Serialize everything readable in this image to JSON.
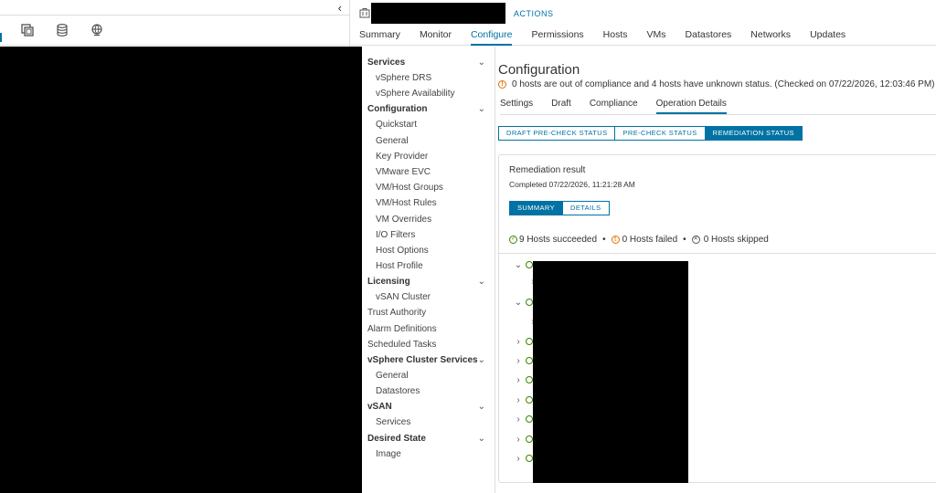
{
  "header": {
    "actions_label": "ACTIONS",
    "tabs": [
      {
        "label": "Summary",
        "active": false
      },
      {
        "label": "Monitor",
        "active": false
      },
      {
        "label": "Configure",
        "active": true
      },
      {
        "label": "Permissions",
        "active": false
      },
      {
        "label": "Hosts",
        "active": false
      },
      {
        "label": "VMs",
        "active": false
      },
      {
        "label": "Datastores",
        "active": false
      },
      {
        "label": "Networks",
        "active": false
      },
      {
        "label": "Updates",
        "active": false
      }
    ]
  },
  "left_pane": {
    "collapse_glyph": "‹",
    "icons": [
      "hosts-clusters-icon",
      "vms-templates-icon",
      "storage-icon",
      "networking-icon"
    ]
  },
  "side_nav": {
    "services": {
      "label": "Services",
      "items": [
        "vSphere DRS",
        "vSphere Availability"
      ]
    },
    "configuration": {
      "label": "Configuration",
      "items": [
        "Quickstart",
        "General",
        "Key Provider",
        "VMware EVC",
        "VM/Host Groups",
        "VM/Host Rules",
        "VM Overrides",
        "I/O Filters",
        "Host Options",
        "Host Profile"
      ]
    },
    "licensing": {
      "label": "Licensing",
      "items": [
        "vSAN Cluster"
      ]
    },
    "top_items": [
      "Trust Authority",
      "Alarm Definitions",
      "Scheduled Tasks"
    ],
    "cluster_services": {
      "label": "vSphere Cluster Services",
      "items": [
        "General",
        "Datastores"
      ]
    },
    "vsan": {
      "label": "vSAN",
      "items": [
        "Services"
      ]
    },
    "desired_state": {
      "label": "Desired State",
      "items": [
        "Image"
      ]
    }
  },
  "content": {
    "title": "Configuration",
    "warning": "0 hosts are out of compliance and 4 hosts have unknown status. (Checked on 07/22/2026, 12:03:46 PM)",
    "sub_tabs": [
      {
        "label": "Settings",
        "active": false
      },
      {
        "label": "Draft",
        "active": false
      },
      {
        "label": "Compliance",
        "active": false
      },
      {
        "label": "Operation Details",
        "active": true
      }
    ],
    "status_buttons": [
      {
        "label": "DRAFT PRE-CHECK STATUS",
        "active": false
      },
      {
        "label": "PRE-CHECK STATUS",
        "active": false
      },
      {
        "label": "REMEDIATION STATUS",
        "active": true
      }
    ],
    "result": {
      "heading": "Remediation result",
      "completed": "Completed 07/22/2026, 11:21:28 AM",
      "summary_label": "SUMMARY",
      "details_label": "DETAILS",
      "succeeded": "9 Hosts succeeded",
      "failed": "0 Hosts failed",
      "skipped": "0 Hosts skipped",
      "separator": "•"
    }
  },
  "colors": {
    "accent": "#0072a3",
    "success": "#3c8500",
    "warning": "#e57200"
  }
}
